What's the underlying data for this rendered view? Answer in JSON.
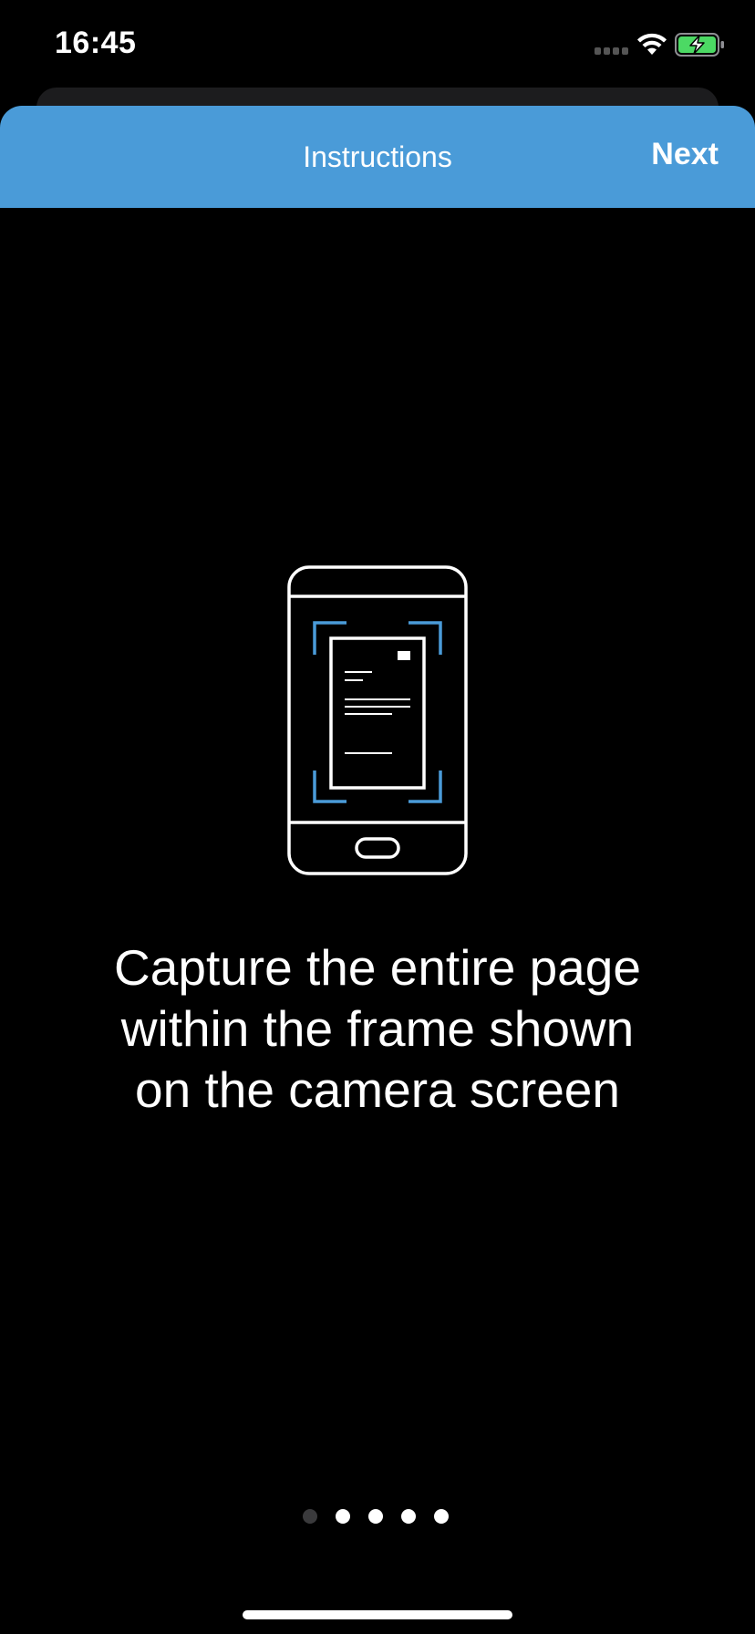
{
  "status_bar": {
    "time": "16:45",
    "signal_icon": "cellular-signal-icon",
    "wifi_icon": "wifi-icon",
    "battery_icon": "battery-charging-icon",
    "battery_color": "#4cd964"
  },
  "header": {
    "title": "Instructions",
    "next_label": "Next",
    "background_color": "#4a9bd8"
  },
  "illustration": {
    "icon": "phone-document-scan-icon",
    "accent_color": "#4a9bd8"
  },
  "instruction": {
    "text": "Capture the entire page\nwithin the frame shown\non the camera screen"
  },
  "pager": {
    "total": 5,
    "current": 1
  }
}
